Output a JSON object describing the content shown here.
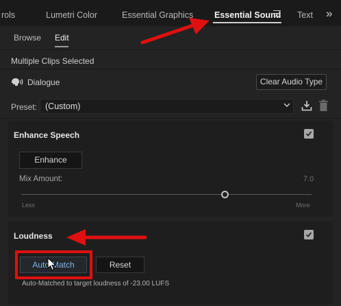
{
  "tabs": [
    {
      "label": "rols",
      "active": false
    },
    {
      "label": "Lumetri Color",
      "active": false
    },
    {
      "label": "Essential Graphics",
      "active": false
    },
    {
      "label": "Essential Sound",
      "active": true
    },
    {
      "label": "Text",
      "active": false
    }
  ],
  "icons": {
    "panel_menu": "hamburger-menu-icon",
    "overflow": "double-chevron-right-icon",
    "dialogue": "speaking-head-icon",
    "preset_dropdown": "chevron-down-icon",
    "save_preset": "download-icon",
    "delete_preset": "trash-icon",
    "checkbox": "checkmark-icon",
    "cursor": "mouse-pointer-icon",
    "annotation": "red-arrow-icon"
  },
  "subtabs": [
    {
      "label": "Browse",
      "active": false
    },
    {
      "label": "Edit",
      "active": true
    }
  ],
  "clips_label": "Multiple Clips Selected",
  "audio_type": {
    "label": "Dialogue",
    "clear_button": "Clear Audio Type"
  },
  "preset": {
    "label": "Preset:",
    "value": "(Custom)"
  },
  "enhance_speech": {
    "title": "Enhance Speech",
    "checked": true,
    "button": "Enhance",
    "mix_label": "Mix Amount:",
    "mix_value": "7.0",
    "less_label": "Less",
    "more_label": "More"
  },
  "loudness": {
    "title": "Loudness",
    "checked": true,
    "auto_match_button": "Auto-Match",
    "reset_button": "Reset",
    "status": "Auto-Matched to target loudness of -23.00 LUFS"
  },
  "colors": {
    "accent_text": "#7fb4ea",
    "annotation_red": "#e01010",
    "panel_bg": "#232323"
  }
}
